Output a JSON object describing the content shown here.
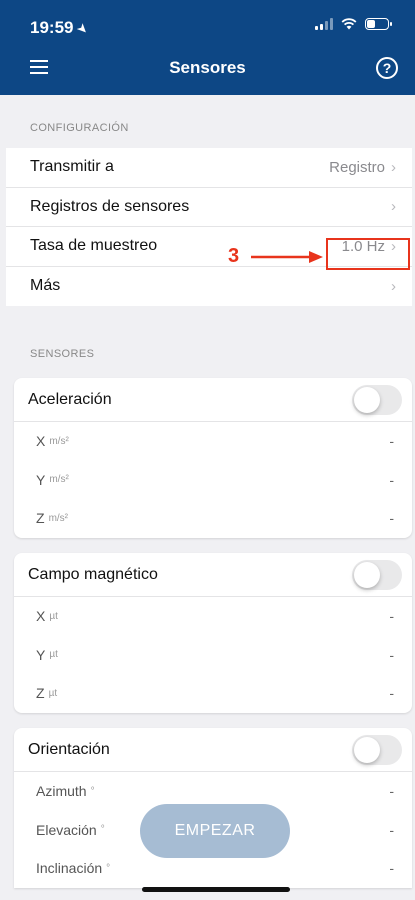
{
  "status_bar": {
    "time": "19:59",
    "location_arrow": "location-arrow-icon"
  },
  "header": {
    "title": "Sensores",
    "menu_icon": "menu-icon",
    "help_icon": "help-icon",
    "help_glyph": "?"
  },
  "configuration": {
    "section_label": "CONFIGURACIÓN",
    "rows": [
      {
        "label": "Transmitir a",
        "value": "Registro"
      },
      {
        "label": "Registros de sensores",
        "value": ""
      },
      {
        "label": "Tasa de muestreo",
        "value": "1.0 Hz"
      },
      {
        "label": "Más",
        "value": ""
      }
    ],
    "annotation": {
      "number": "3",
      "color": "#e8341c"
    }
  },
  "sensors": {
    "section_label": "SENSORES",
    "cards": [
      {
        "title": "Aceleración",
        "enabled": false,
        "rows": [
          {
            "name": "X",
            "unit": "m/s²",
            "value": "-"
          },
          {
            "name": "Y",
            "unit": "m/s²",
            "value": "-"
          },
          {
            "name": "Z",
            "unit": "m/s²",
            "value": "-"
          }
        ]
      },
      {
        "title": "Campo magnético",
        "enabled": false,
        "rows": [
          {
            "name": "X",
            "unit": "µt",
            "value": "-"
          },
          {
            "name": "Y",
            "unit": "µt",
            "value": "-"
          },
          {
            "name": "Z",
            "unit": "µt",
            "value": "-"
          }
        ]
      },
      {
        "title": "Orientación",
        "enabled": false,
        "rows": [
          {
            "name": "Azimuth",
            "unit": "°",
            "value": "-"
          },
          {
            "name": "Elevación",
            "unit": "°",
            "value": "-"
          },
          {
            "name": "Inclinación",
            "unit": "°",
            "value": "-"
          }
        ]
      }
    ]
  },
  "start_button": {
    "label": "EMPEZAR"
  },
  "colors": {
    "header": "#0d4785",
    "start_button": "#a6bcd3",
    "annotation": "#e8341c"
  }
}
